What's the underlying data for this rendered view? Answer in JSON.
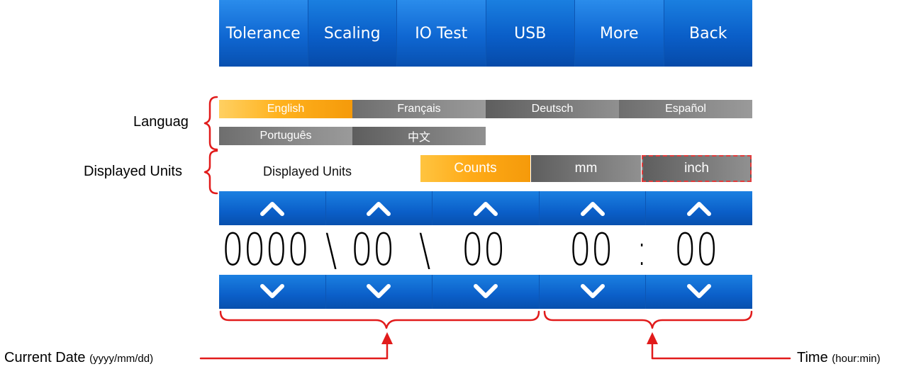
{
  "nav": {
    "items": [
      "Tolerance",
      "Scaling",
      "IO Test",
      "USB",
      "More",
      "Back"
    ]
  },
  "language": {
    "options": [
      "English",
      "Français",
      "Deutsch",
      "Español",
      "Português",
      "中文"
    ],
    "selected": "English"
  },
  "units": {
    "label": "Displayed Units",
    "options": [
      "Counts",
      "mm",
      "inch"
    ],
    "selected": "Counts"
  },
  "datetime": {
    "year": "0000",
    "sep1": "\\",
    "month": "00",
    "sep2": "\\",
    "day": "00",
    "hour": "00",
    "colon": ":",
    "minute": "00"
  },
  "annotations": {
    "language": "Languag",
    "units": "Displayed Units",
    "date_main": "Current Date",
    "date_sub": "(yyyy/mm/dd)",
    "time_main": "Time",
    "time_sub": "(hour:min)"
  },
  "colors": {
    "nav_blue": "#0a5ec8",
    "selected_orange": "#ffb21e",
    "button_gray": "#7c7c7c",
    "annotation_red": "#e11b1b"
  }
}
